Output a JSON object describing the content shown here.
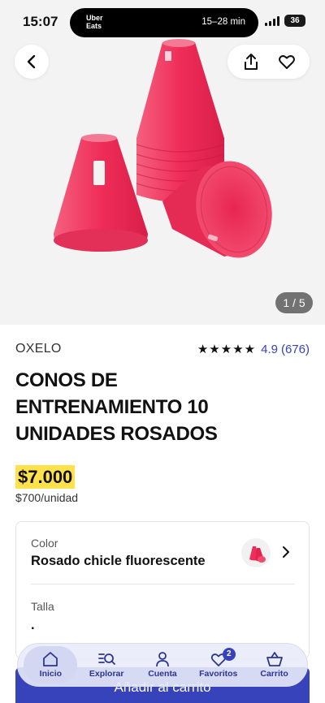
{
  "status_bar": {
    "time": "15:07",
    "live_activity": {
      "brand_line1": "Uber",
      "brand_line2": "Eats",
      "eta": "15–28 min"
    },
    "battery": "36"
  },
  "gallery": {
    "counter": "1 / 5",
    "back_icon": "chevron-left-icon",
    "share_icon": "share-icon",
    "favorite_icon": "heart-icon"
  },
  "product": {
    "brand": "OXELO",
    "rating": {
      "stars": "★★★★★",
      "value": "4.9",
      "count": "(676)"
    },
    "title": "CONOS DE ENTRENAMIENTO 10 UNIDADES ROSADOS",
    "price": "$7.000",
    "unit_price": "$700/unidad"
  },
  "options": {
    "color": {
      "label": "Color",
      "value": "Rosado chicle fluorescente"
    },
    "size": {
      "label": "Talla",
      "value": "."
    }
  },
  "cart_button": {
    "label": "Añadir al carrito"
  },
  "tabbar": {
    "items": [
      {
        "label": "Inicio",
        "icon": "home-icon"
      },
      {
        "label": "Explorar",
        "icon": "search-list-icon"
      },
      {
        "label": "Cuenta",
        "icon": "person-icon"
      },
      {
        "label": "Favoritos",
        "icon": "heart-icon",
        "badge": "2"
      },
      {
        "label": "Carrito",
        "icon": "basket-icon"
      }
    ]
  },
  "colors": {
    "accent": "#3643ba",
    "price_highlight": "#ffe14c",
    "product_pink": "#f0325e"
  }
}
